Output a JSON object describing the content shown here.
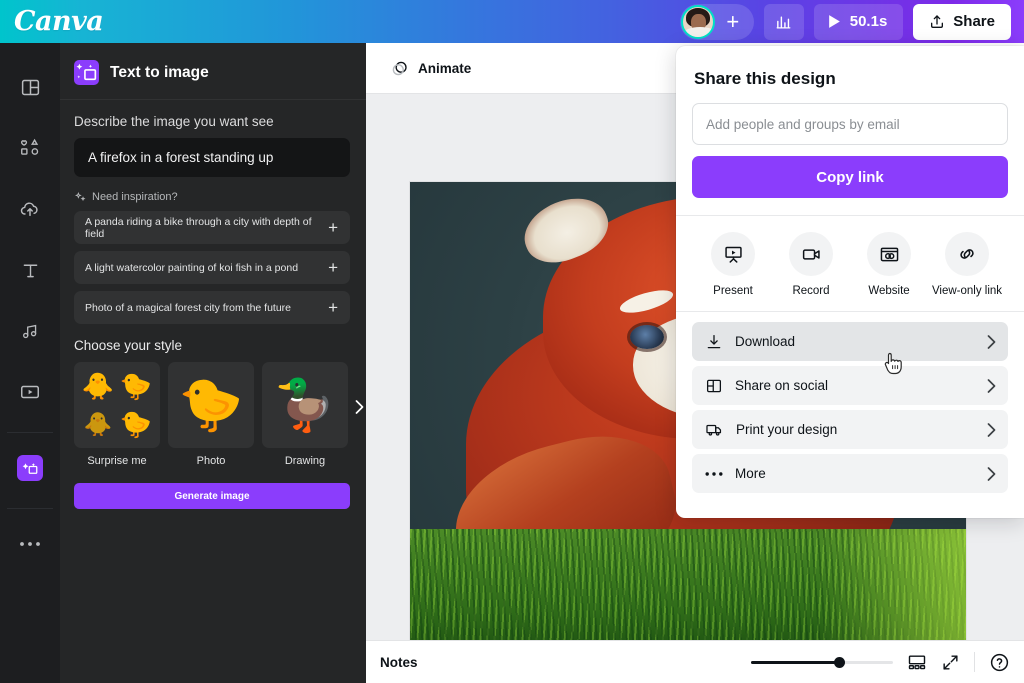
{
  "app": {
    "brand": "Canva"
  },
  "topbar": {
    "avatar_name": "user-avatar",
    "add_collaborator_label": "+",
    "stats_icon": "bar-chart-icon",
    "timer_label": "50.1s",
    "play_icon": "play-icon",
    "share_label": "Share",
    "share_icon": "upload-icon"
  },
  "rail": {
    "items": [
      {
        "name": "design",
        "icon": "layout-icon"
      },
      {
        "name": "elements",
        "icon": "shapes-icon"
      },
      {
        "name": "uploads",
        "icon": "cloud-upload-icon"
      },
      {
        "name": "text",
        "icon": "text-icon"
      },
      {
        "name": "audio",
        "icon": "music-note-icon"
      },
      {
        "name": "videos",
        "icon": "video-player-icon"
      },
      {
        "name": "apps",
        "icon": "magic-media-icon"
      },
      {
        "name": "more",
        "icon": "ellipsis-icon"
      }
    ]
  },
  "panel": {
    "title": "Text to image",
    "icon": "magic-media-icon",
    "prompt_label": "Describe the image you want see",
    "prompt_value": "A firefox in a forest standing up",
    "prompt_placeholder": "Describe the image you want see",
    "inspiration_label": "Need inspiration?",
    "inspiration_icon": "sparkle-icon",
    "suggestions": [
      "A panda riding a bike through a city with depth of field",
      "A light watercolor painting of koi fish in a pond",
      "Photo of a magical forest city from the future"
    ],
    "suggestion_add_label": "+",
    "style_title": "Choose your style",
    "styles": [
      {
        "label": "Surprise me",
        "thumb": "four-ducks-grid"
      },
      {
        "label": "Photo",
        "thumb": "photo-duck"
      },
      {
        "label": "Drawing",
        "thumb": "drawing-duck"
      }
    ],
    "carousel_next_icon": "chevron-right-icon",
    "generate_label": "Generate image"
  },
  "editor": {
    "animate_label": "Animate",
    "animate_icon": "animate-circles-icon",
    "canvas_alt": "AI generated red panda standing in grass"
  },
  "bottombar": {
    "notes_label": "Notes",
    "zoom_percent": 62,
    "pages_icon": "grid-view-icon",
    "fullscreen_icon": "expand-icon",
    "help_icon": "question-mark-icon"
  },
  "share": {
    "title": "Share this design",
    "email_placeholder": "Add people and groups by email",
    "email_value": "",
    "copy_link_label": "Copy link",
    "quick_actions": [
      {
        "label": "Present",
        "icon": "present-screen-icon"
      },
      {
        "label": "Record",
        "icon": "video-camera-icon"
      },
      {
        "label": "Website",
        "icon": "website-window-icon"
      },
      {
        "label": "View-only link",
        "icon": "link-chain-icon"
      }
    ],
    "menu_items": [
      {
        "label": "Download",
        "icon": "download-arrow-icon",
        "hovered": true
      },
      {
        "label": "Share on social",
        "icon": "panels-icon",
        "hovered": false
      },
      {
        "label": "Print your design",
        "icon": "delivery-truck-icon",
        "hovered": false
      },
      {
        "label": "More",
        "icon": "ellipsis-icon",
        "hovered": false
      }
    ],
    "chevron": "›"
  },
  "colors": {
    "brand_purple": "#8b3dfc",
    "brand_teal": "#00c4cc",
    "panel_bg": "#252627",
    "rail_bg": "#1d1e20",
    "editor_bg": "#edeef0"
  }
}
